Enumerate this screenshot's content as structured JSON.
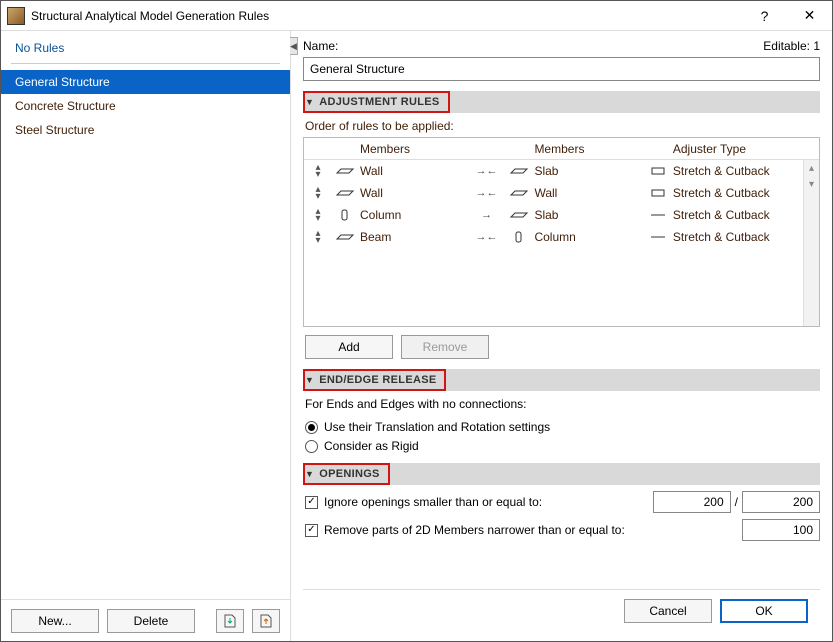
{
  "window": {
    "title": "Structural Analytical Model Generation Rules"
  },
  "sidebar": {
    "heading": "No Rules",
    "items": [
      {
        "label": "General Structure",
        "selected": true
      },
      {
        "label": "Concrete Structure",
        "selected": false
      },
      {
        "label": "Steel Structure",
        "selected": false
      }
    ],
    "buttons": {
      "new": "New...",
      "delete": "Delete"
    }
  },
  "form": {
    "name_label": "Name:",
    "editable_label": "Editable: 1",
    "name_value": "General Structure"
  },
  "sections": {
    "adjustment": {
      "title": "ADJUSTMENT RULES",
      "order_label": "Order of rules to be applied:",
      "headers": {
        "m1": "Members",
        "m2": "Members",
        "adj": "Adjuster Type"
      },
      "rows": [
        {
          "icon1": "slab",
          "m1": "Wall",
          "arrow": "bi",
          "icon2": "slab",
          "m2": "Slab",
          "aicon": "stretch",
          "adj": "Stretch & Cutback"
        },
        {
          "icon1": "slab",
          "m1": "Wall",
          "arrow": "bi",
          "icon2": "slab",
          "m2": "Wall",
          "aicon": "stretch",
          "adj": "Stretch & Cutback"
        },
        {
          "icon1": "col",
          "m1": "Column",
          "arrow": "right",
          "icon2": "slab",
          "m2": "Slab",
          "aicon": "line",
          "adj": "Stretch & Cutback"
        },
        {
          "icon1": "slab",
          "m1": "Beam",
          "arrow": "bi",
          "icon2": "col",
          "m2": "Column",
          "aicon": "line",
          "adj": "Stretch & Cutback"
        }
      ],
      "buttons": {
        "add": "Add",
        "remove": "Remove"
      }
    },
    "release": {
      "title": "END/EDGE RELEASE",
      "desc": "For Ends and Edges with no connections:",
      "opt1": "Use their Translation and Rotation settings",
      "opt2": "Consider as Rigid"
    },
    "openings": {
      "title": "OPENINGS",
      "ignore_label": "Ignore openings smaller than or equal to:",
      "ignore_w": "200",
      "ignore_h": "200",
      "remove_label": "Remove parts of 2D Members narrower than or equal to:",
      "remove_v": "100"
    }
  },
  "footer": {
    "cancel": "Cancel",
    "ok": "OK"
  }
}
